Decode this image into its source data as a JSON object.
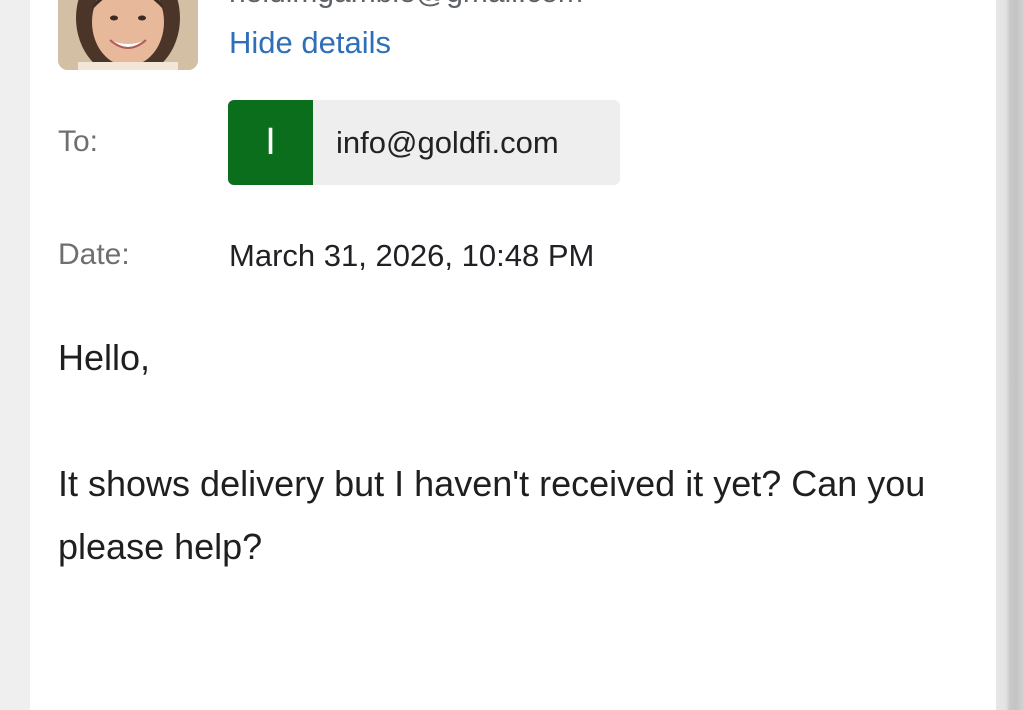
{
  "header": {
    "sender_email_partial": "heidimgamble@gmail.com",
    "hide_details_link": "Hide details"
  },
  "fields": {
    "to_label": "To:",
    "recipient": {
      "initial": "I",
      "email": "info@goldfi.com",
      "chip_color": "#0a6e1d"
    },
    "date_label": "Date:",
    "date_value": "March 31, 2026, 10:48 PM"
  },
  "body": {
    "greeting": "Hello,",
    "message": "It shows delivery but I haven't received it yet? Can you please help?"
  },
  "colors": {
    "link": "#2f6fb7",
    "label": "#6f6f6f",
    "text": "#1f1f1f"
  }
}
